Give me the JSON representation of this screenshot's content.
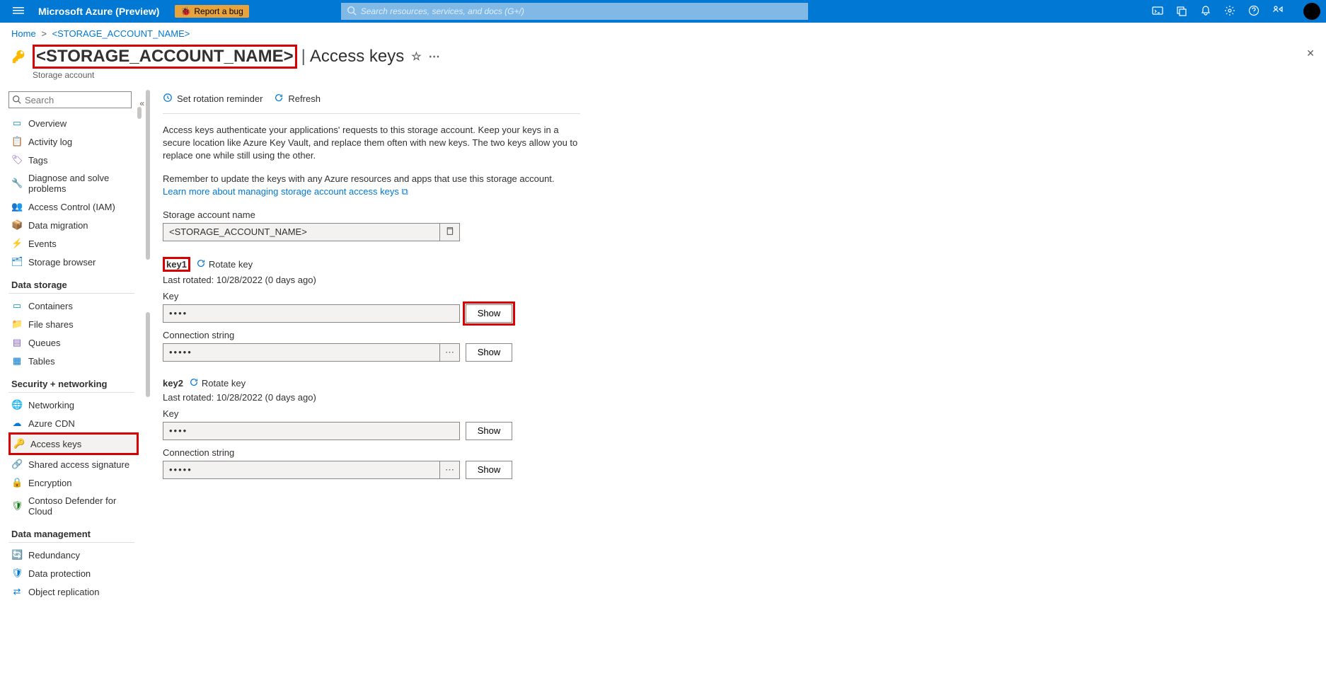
{
  "topbar": {
    "brand": "Microsoft Azure (Preview)",
    "report_bug": "Report a bug",
    "search_placeholder": "Search resources, services, and docs (G+/)"
  },
  "breadcrumb": {
    "home": "Home",
    "current": "<STORAGE_ACCOUNT_NAME>"
  },
  "page": {
    "title": "<STORAGE_ACCOUNT_NAME>",
    "section": "Access keys",
    "subtitle": "Storage account"
  },
  "sidebar": {
    "search_placeholder": "Search",
    "items_top": [
      {
        "label": "Overview"
      },
      {
        "label": "Activity log"
      },
      {
        "label": "Tags"
      },
      {
        "label": "Diagnose and solve problems"
      },
      {
        "label": "Access Control (IAM)"
      },
      {
        "label": "Data migration"
      },
      {
        "label": "Events"
      },
      {
        "label": "Storage browser"
      }
    ],
    "group_storage": "Data storage",
    "items_storage": [
      {
        "label": "Containers"
      },
      {
        "label": "File shares"
      },
      {
        "label": "Queues"
      },
      {
        "label": "Tables"
      }
    ],
    "group_security": "Security + networking",
    "items_security": [
      {
        "label": "Networking"
      },
      {
        "label": "Azure CDN"
      },
      {
        "label": "Access keys"
      },
      {
        "label": "Shared access signature"
      },
      {
        "label": "Encryption"
      },
      {
        "label": "Contoso Defender for Cloud"
      }
    ],
    "group_datamgmt": "Data management",
    "items_datamgmt": [
      {
        "label": "Redundancy"
      },
      {
        "label": "Data protection"
      },
      {
        "label": "Object replication"
      }
    ]
  },
  "toolbar": {
    "rotation": "Set rotation reminder",
    "refresh": "Refresh"
  },
  "desc": {
    "p1": "Access keys authenticate your applications' requests to this storage account. Keep your keys in a secure location like Azure Key Vault, and replace them often with new keys. The two keys allow you to replace one while still using the other.",
    "p2": "Remember to update the keys with any Azure resources and apps that use this storage account.",
    "learn": "Learn more about managing storage account access keys"
  },
  "fields": {
    "account_name_label": "Storage account name",
    "account_name_value": "<STORAGE_ACCOUNT_NAME>"
  },
  "keys": {
    "rotate_label": "Rotate key",
    "key_label": "Key",
    "conn_label": "Connection string",
    "show_label": "Show",
    "masked_short": "••••",
    "masked_long": "•••••",
    "key1": {
      "name": "key1",
      "last_rotated": "Last rotated: 10/28/2022 (0 days ago)"
    },
    "key2": {
      "name": "key2",
      "last_rotated": "Last rotated: 10/28/2022 (0 days ago)"
    }
  }
}
